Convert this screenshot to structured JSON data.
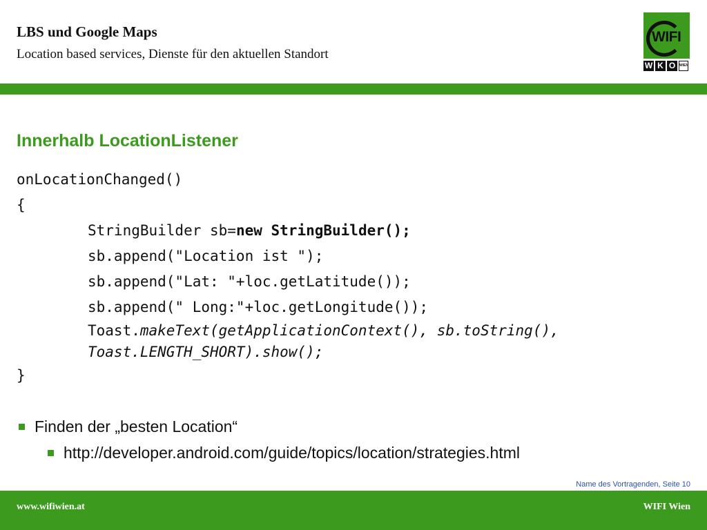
{
  "header": {
    "title": "LBS und Google Maps",
    "subtitle": "Location based services, Dienste für den aktuellen Standort"
  },
  "logo": {
    "name": "WIFI",
    "cells": [
      "W",
      "K",
      "O"
    ],
    "small_text": "WIEN"
  },
  "section": {
    "heading": "Innerhalb LocationListener"
  },
  "code": {
    "line1": "onLocationChanged()",
    "line2": "{",
    "line3_a": "StringBuilder sb=",
    "line3_b": "new StringBuilder();",
    "line4": "sb.append(\"Location ist \");",
    "line5": "sb.append(\"Lat: \"+loc.getLatitude());",
    "line6": "sb.append(\" Long:\"+loc.getLongitude());",
    "line7_a": "Toast.",
    "line7_b": "makeText(getApplicationContext(), sb.toString(), Toast.LENGTH_SHORT).show();",
    "line8": "}"
  },
  "bullets": {
    "item1": "Finden der „besten Location“",
    "item2": "http://developer.android.com/guide/topics/location/strategies.html"
  },
  "footer": {
    "note": "Name des Vortragenden, Seite 10",
    "left": "www.wifiwien.at",
    "right": "WIFI Wien"
  },
  "colors": {
    "brand_green": "#3c9a1f",
    "footer_link_blue": "#2b4fb3"
  }
}
